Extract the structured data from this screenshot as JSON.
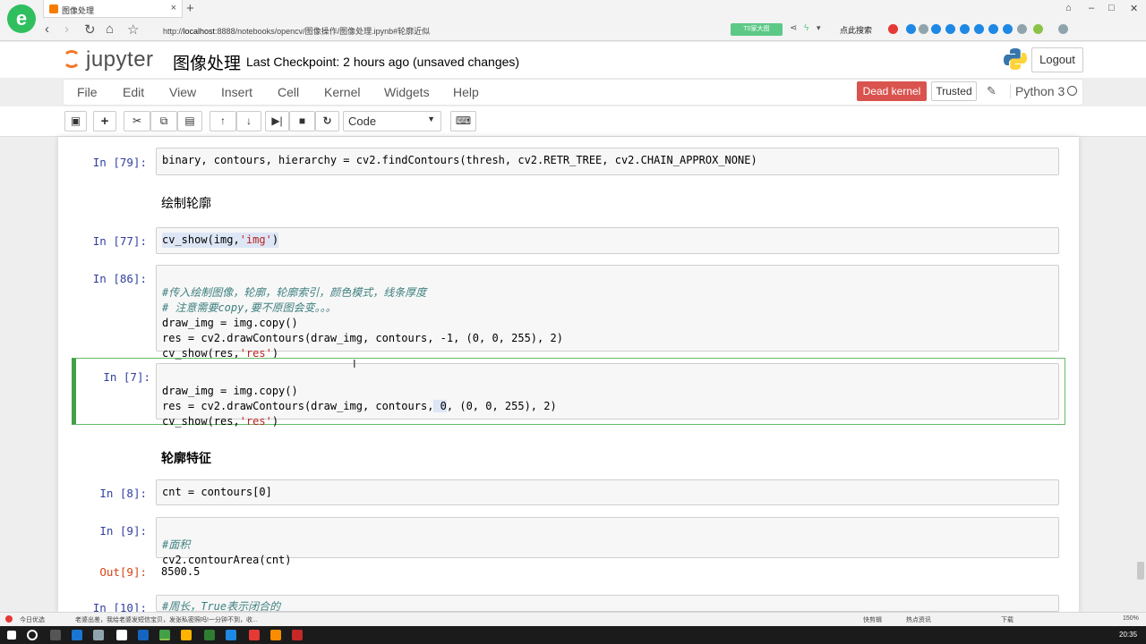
{
  "browser": {
    "tab_title": "图像处理",
    "tab_close": "×",
    "new_tab": "+",
    "url_prefix": "http://",
    "url_host": "localhost",
    "url_rest": ":8888/notebooks/opencv/图像操作/图像处理.ipynb#轮廓近似",
    "extension_badge": "T0家大图",
    "search_label": "点此搜索",
    "logo_letter": "e",
    "nav_icons": [
      "back-icon",
      "forward-icon",
      "refresh-icon",
      "home-icon",
      "star-icon"
    ]
  },
  "jupyter": {
    "logo_text": "jupyter",
    "notebook_name": "图像处理",
    "checkpoint": "Last Checkpoint: 2 hours ago (unsaved changes)",
    "logout": "Logout",
    "menu": [
      "File",
      "Edit",
      "View",
      "Insert",
      "Cell",
      "Kernel",
      "Widgets",
      "Help"
    ],
    "kernel_status": "Dead kernel",
    "trusted": "Trusted",
    "kernel_name": "Python 3",
    "cell_type": "Code",
    "toolbar_icons": [
      "save-icon",
      "add-cell-icon",
      "cut-icon",
      "copy-icon",
      "paste-icon",
      "move-up-icon",
      "move-down-icon",
      "run-icon",
      "stop-icon",
      "restart-icon",
      "keyboard-icon"
    ]
  },
  "cells": {
    "c79_prompt": "In [79]:",
    "c79_code": "binary, contours, hierarchy = cv2.findContours(thresh, cv2.RETR_TREE, cv2.CHAIN_APPROX_NONE)",
    "md_draw": "绘制轮廓",
    "c77_prompt": "In [77]:",
    "c77_code_a": "cv_show(img,",
    "c77_code_str": "'img'",
    "c77_code_b": ")",
    "c86_prompt": "In [86]:",
    "c86_l1": "#传入绘制图像，轮廓，轮廓索引，颜色模式，线条厚度",
    "c86_l2": "# 注意需要copy,要不原图会变。。。",
    "c86_l3": "draw_img = img.copy()",
    "c86_l4": "res = cv2.drawContours(draw_img, contours, -1, (0, 0, 255), 2)",
    "c86_l5_a": "cv_show(res,",
    "c86_l5_str": "'res'",
    "c86_l5_b": ")",
    "c7_prompt": "In [7]:",
    "c7_l1": "draw_img = img.copy()",
    "c7_l2_a": "res = cv2.drawContours(draw_img, contours,",
    "c7_l2_hl": " 0",
    "c7_l2_b": ", (0, 0, 255), 2)",
    "c7_l3_a": "cv_show(res,",
    "c7_l3_str": "'res'",
    "c7_l3_b": ")",
    "md_features": "轮廓特征",
    "c8_prompt": "In [8]:",
    "c8_code": "cnt = contours[0]",
    "c9_prompt": "In [9]:",
    "c9_l1": "#面积",
    "c9_l2": "cv2.contourArea(cnt)",
    "out9_prompt": "Out[9]:",
    "out9_value": "8500.5",
    "c10_prompt": "In [10]:",
    "c10_l1": "#周长，True表示闭合的"
  },
  "statusbar": {
    "left_label": "今日优选",
    "news": "老婆出差，我给老婆发短信宝贝，发张私密照吗!一分钟不到，收...",
    "right_a": "快剪辑",
    "right_b": "热点资讯",
    "right_c": "下载",
    "zoom": "150%"
  },
  "taskbar": {
    "clock": "20:35"
  }
}
